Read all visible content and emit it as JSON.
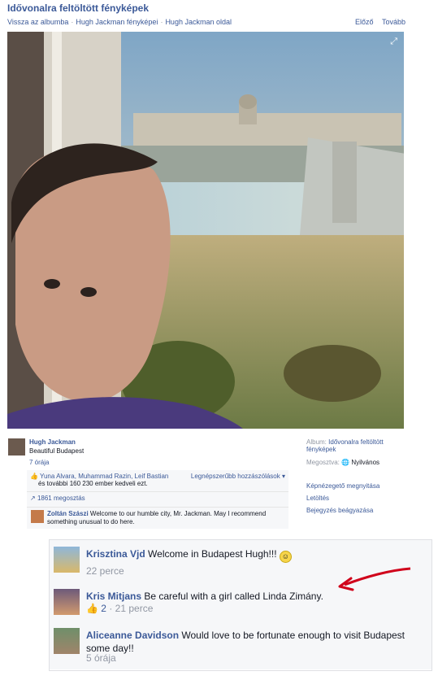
{
  "header": {
    "title": "Idővonalra feltöltött fényképek",
    "nav": [
      "Vissza az albumba",
      "Hugh Jackman fényképei",
      "Hugh Jackman oldal"
    ],
    "prev": "Előző",
    "next": "Tovább"
  },
  "post": {
    "author": "Hugh Jackman",
    "caption": "Beautiful Budapest",
    "time": "7 órája"
  },
  "side": {
    "album_label": "Album:",
    "album_value": "Idővonalra feltöltött fényképek",
    "share_label": "Megosztva:",
    "share_value": "Nyilvános",
    "links": [
      "Képnézegető megnyitása",
      "Letöltés",
      "Bejegyzés beágyazása"
    ]
  },
  "likes": {
    "names": "Yuna Alvara, Muhammad Razin, Leif Bastian",
    "rest": "és további 160 230 ember kedveli ezt.",
    "more": "Legnépszerűbb hozzászólások",
    "shares": "1861 megosztás"
  },
  "comment": {
    "author": "Zoltán Szászi",
    "text": "Welcome to our humble city, Mr. Jackman. May I recommend something unusual to do here."
  },
  "zoomed_comments": [
    {
      "author": "Krisztina Vjd",
      "text": "Welcome in Budapest Hugh!!!",
      "time": "22 perce"
    },
    {
      "author": "Kris Mitjans",
      "text": "Be careful with a girl called Linda Zimány.",
      "likes": "2",
      "time": "21 perce"
    },
    {
      "author": "Aliceanne Davidson",
      "text": "Would love to be fortunate enough to visit Budapest some day!!",
      "time": "5 órája"
    }
  ],
  "colors": {
    "link": "#3b5998",
    "arrow": "#d0021b"
  },
  "icons": [
    "expand-icon",
    "globe-icon",
    "share-icon",
    "like-thumb-icon",
    "smiley-icon",
    "red-arrow"
  ]
}
